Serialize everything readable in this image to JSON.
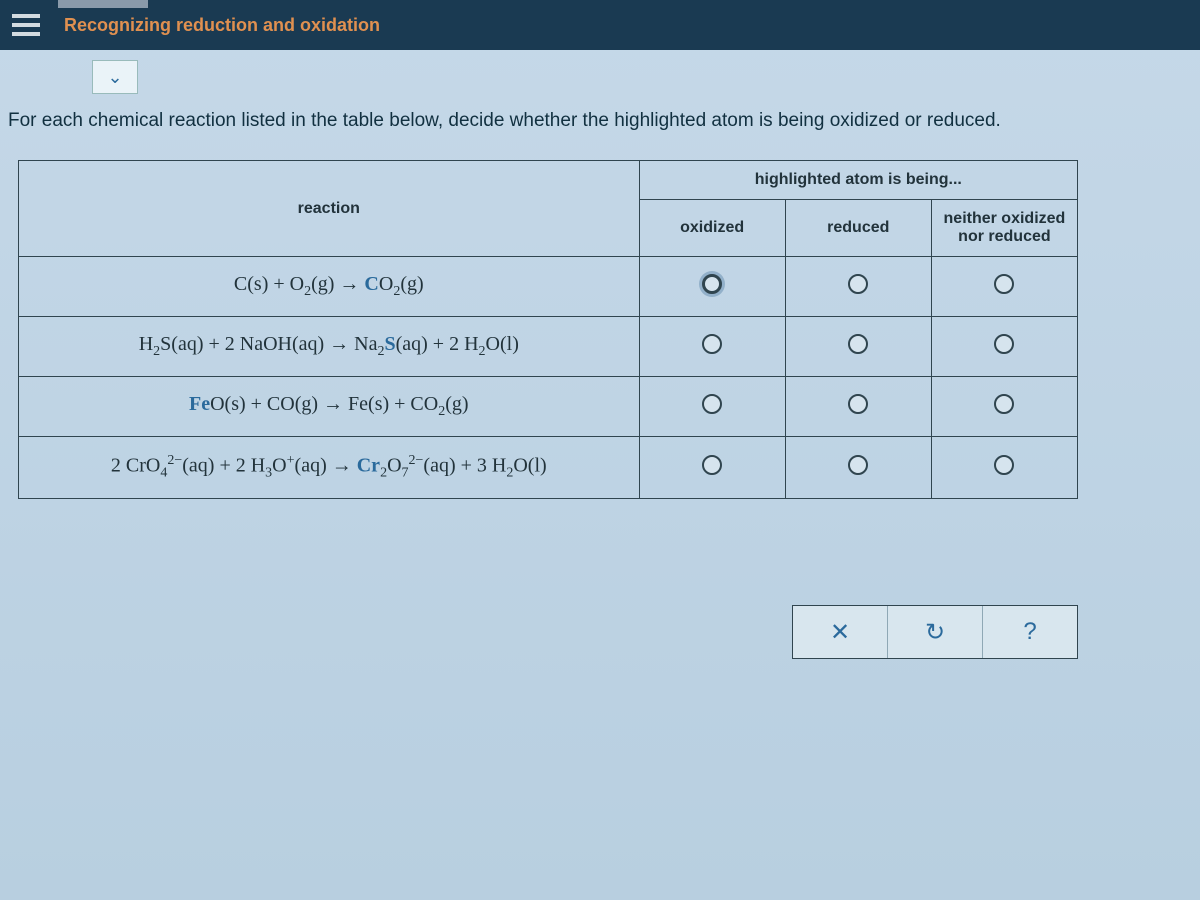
{
  "topbar": {
    "title": "Recognizing reduction and oxidation"
  },
  "chevron": "⌄",
  "prompt": "For each chemical reaction listed in the table below, decide whether the highlighted atom is being oxidized or reduced.",
  "table": {
    "header": {
      "super": "highlighted atom is being...",
      "reaction": "reaction",
      "oxidized": "oxidized",
      "reduced": "reduced",
      "neither": "neither oxidized nor reduced"
    },
    "rows": [
      {
        "reaction_html": "C(s) + O<sub>2</sub>(g) → <span class='hl'>C</span>O<sub>2</sub>(g)",
        "focus_col": 0
      },
      {
        "reaction_html": "H<sub>2</sub>S(aq) + 2 NaOH(aq) → Na<sub>2</sub><span class='hl'>S</span>(aq) + 2 H<sub>2</sub>O(l)",
        "focus_col": -1
      },
      {
        "reaction_html": "<span class='hl'>Fe</span>O(s) + CO(g) → Fe(s) + CO<sub>2</sub>(g)",
        "focus_col": -1
      },
      {
        "reaction_html": "2 CrO<sub>4</sub><sup>2−</sup>(aq) + 2 H<sub>3</sub>O<sup>+</sup>(aq) → <span class='hl'>Cr</span><sub>2</sub>O<sub>7</sub><sup>2−</sup>(aq) + 3 H<sub>2</sub>O(l)",
        "focus_col": -1
      }
    ]
  },
  "controls": {
    "clear": "✕",
    "reset": "↻",
    "help": "?"
  }
}
